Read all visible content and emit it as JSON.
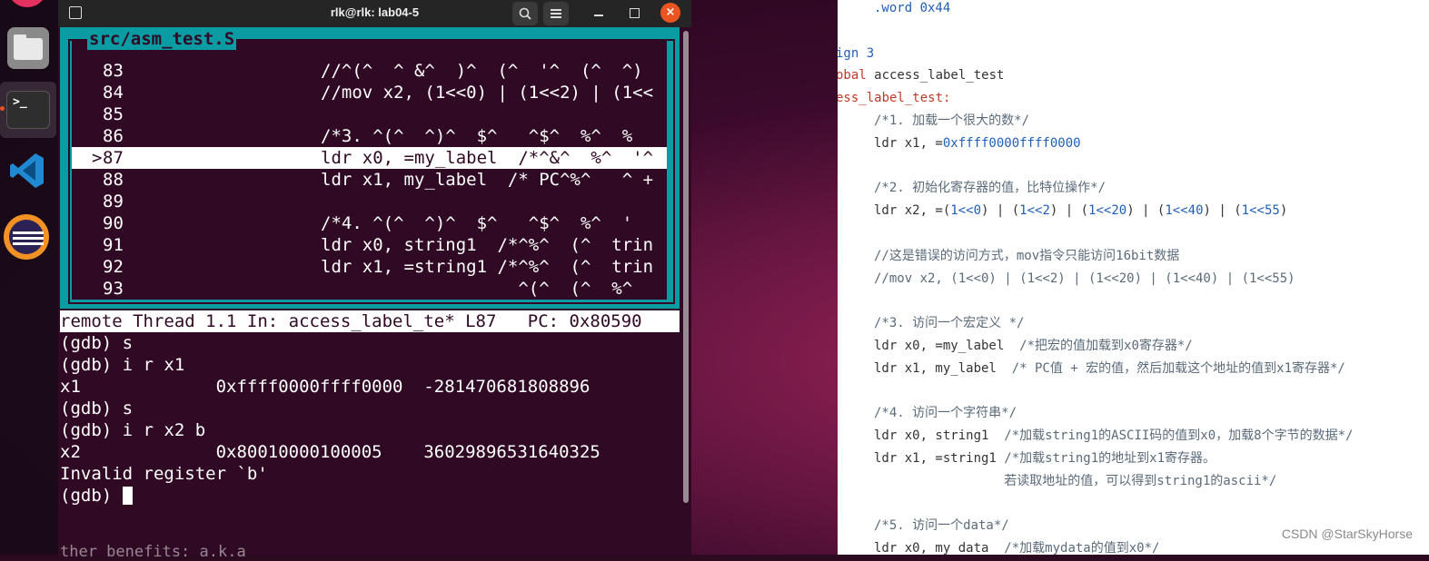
{
  "colors": {
    "terminal_bg": "#300a24",
    "tui_border": "#0b9ba3",
    "close": "#e95420",
    "highlight": "#ffffff"
  },
  "dock": {
    "icons": [
      "app-icon",
      "files-icon",
      "terminal-icon",
      "vscode-icon",
      "eclipse-icon"
    ],
    "terminal_glyph": ">_"
  },
  "terminal": {
    "title": "rlk@rlk: lab04-5",
    "close_glyph": "×",
    "new_tab_glyph": "+",
    "source_panel": {
      "title": "src/asm_test.S",
      "current_marker": ">",
      "lines": [
        {
          "n": "83",
          "code": "//^(^  ^ &^  )^  (^  '^  (^  ^)"
        },
        {
          "n": "84",
          "code": "//mov x2, (1<<0) | (1<<2) | (1<<"
        },
        {
          "n": "85",
          "code": ""
        },
        {
          "n": "86",
          "code": "/*3. ^(^  ^)^  $^   ^$^  %^  %"
        },
        {
          "n": "87",
          "code": "ldr x0, =my_label  /*^&^  %^  '^"
        },
        {
          "n": "88",
          "code": "ldr x1, my_label  /* PC^%^   ^ +"
        },
        {
          "n": "89",
          "code": ""
        },
        {
          "n": "90",
          "code": "/*4. ^(^  ^)^  $^   ^$^  %^  '"
        },
        {
          "n": "91",
          "code": "ldr x0, string1  /*^%^  (^  trin"
        },
        {
          "n": "92",
          "code": "ldr x1, =string1 /*^%^  (^  trin"
        },
        {
          "n": "93",
          "code": "                   ^(^  (^  %^"
        }
      ]
    },
    "status_bar": "remote Thread 1.1 In: access_label_te* L87   PC: 0x80590",
    "gdb_lines": [
      "(gdb) s",
      "(gdb) i r x1",
      "x1             0xffff0000ffff0000  -281470681808896",
      "(gdb) s",
      "(gdb) i r x2 b",
      "x2             0x80010000100005    36029896531640325",
      "Invalid register `b'",
      "(gdb) "
    ],
    "residual_line": "ther benefits: a.k.a"
  },
  "editor": {
    "lines": [
      {
        "indent": 2,
        "parts": [
          {
            "t": ".word 0x44",
            "c": "c-blue"
          }
        ]
      },
      {
        "indent": 0,
        "parts": []
      },
      {
        "indent": 0,
        "parts": [
          {
            "t": "ign 3",
            "c": "c-blue"
          }
        ]
      },
      {
        "indent": 0,
        "parts": [
          {
            "t": "obal",
            "c": "c-red"
          },
          {
            "t": " access_label_test",
            "c": ""
          }
        ]
      },
      {
        "indent": 0,
        "parts": [
          {
            "t": "ess_label_test:",
            "c": "c-red"
          }
        ]
      },
      {
        "indent": 2,
        "parts": [
          {
            "t": "/*1. 加载一个很大的数*/",
            "c": "c-comment"
          }
        ]
      },
      {
        "indent": 2,
        "parts": [
          {
            "t": "ldr x1, =",
            "c": ""
          },
          {
            "t": "0xffff0000ffff0000",
            "c": "c-blue"
          }
        ]
      },
      {
        "indent": 0,
        "parts": []
      },
      {
        "indent": 2,
        "parts": [
          {
            "t": "/*2. 初始化寄存器的值，比特位操作*/",
            "c": "c-comment"
          }
        ]
      },
      {
        "indent": 2,
        "parts": [
          {
            "t": "ldr x2, =(",
            "c": ""
          },
          {
            "t": "1<<0",
            "c": "c-blue"
          },
          {
            "t": ") | (",
            "c": ""
          },
          {
            "t": "1<<2",
            "c": "c-blue"
          },
          {
            "t": ") | (",
            "c": ""
          },
          {
            "t": "1<<20",
            "c": "c-blue"
          },
          {
            "t": ") | (",
            "c": ""
          },
          {
            "t": "1<<40",
            "c": "c-blue"
          },
          {
            "t": ") | (",
            "c": ""
          },
          {
            "t": "1<<55",
            "c": "c-blue"
          },
          {
            "t": ")",
            "c": ""
          }
        ]
      },
      {
        "indent": 0,
        "parts": []
      },
      {
        "indent": 2,
        "parts": [
          {
            "t": "//这是错误的访问方式，mov指令只能访问16bit数据",
            "c": "c-comment"
          }
        ]
      },
      {
        "indent": 2,
        "parts": [
          {
            "t": "//mov x2, (1<<0) | (1<<2) | (1<<20) | (1<<40) | (1<<55)",
            "c": "c-comment"
          }
        ]
      },
      {
        "indent": 0,
        "parts": []
      },
      {
        "indent": 2,
        "parts": [
          {
            "t": "/*3. 访问一个宏定义 */",
            "c": "c-comment"
          }
        ]
      },
      {
        "indent": 2,
        "parts": [
          {
            "t": "ldr x0, =my_label  ",
            "c": ""
          },
          {
            "t": "/*把宏的值加载到x0寄存器*/",
            "c": "c-comment"
          }
        ]
      },
      {
        "indent": 2,
        "parts": [
          {
            "t": "ldr x1, my_label  ",
            "c": ""
          },
          {
            "t": "/* PC值 + 宏的值，然后加载这个地址的值到x1寄存器*/",
            "c": "c-comment"
          }
        ]
      },
      {
        "indent": 0,
        "parts": []
      },
      {
        "indent": 2,
        "parts": [
          {
            "t": "/*4. 访问一个字符串*/",
            "c": "c-comment"
          }
        ]
      },
      {
        "indent": 2,
        "parts": [
          {
            "t": "ldr x0, string1  ",
            "c": ""
          },
          {
            "t": "/*加载string1的ASCII码的值到x0，加载8个字节的数据*/",
            "c": "c-comment"
          }
        ]
      },
      {
        "indent": 2,
        "parts": [
          {
            "t": "ldr x1, =string1 ",
            "c": ""
          },
          {
            "t": "/*加载string1的地址到x1寄存器。",
            "c": "c-comment"
          }
        ]
      },
      {
        "indent": 2,
        "parts": [
          {
            "t": "                 若读取地址的值，可以得到string1的ascii*/",
            "c": "c-comment"
          }
        ]
      },
      {
        "indent": 0,
        "parts": []
      },
      {
        "indent": 2,
        "parts": [
          {
            "t": "/*5. 访问一个data*/",
            "c": "c-comment"
          }
        ]
      },
      {
        "indent": 2,
        "parts": [
          {
            "t": "ldr x0, my_data  ",
            "c": ""
          },
          {
            "t": "/*加载mydata的值到x0*/",
            "c": "c-comment"
          }
        ]
      }
    ],
    "watermark": "CSDN @StarSkyHorse"
  }
}
